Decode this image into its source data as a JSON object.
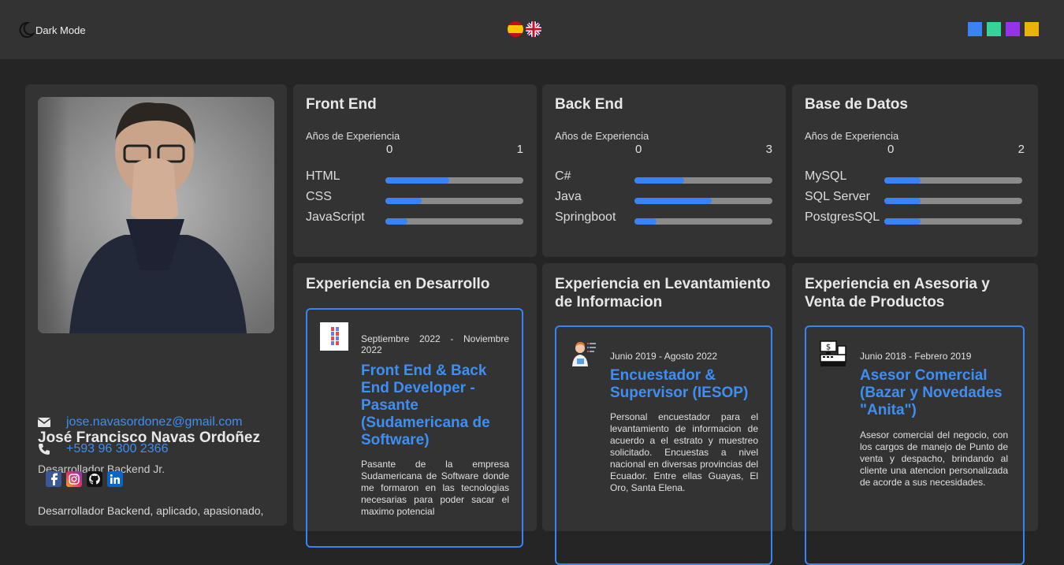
{
  "header": {
    "dark_mode_label": "Dark Mode",
    "flags": [
      "spain-flag-icon",
      "uk-flag-icon"
    ],
    "theme_colors": [
      "#3b82f6",
      "#34d399",
      "#9333ea",
      "#eab308"
    ]
  },
  "profile": {
    "name": "José Francisco Navas Ordoñez",
    "role": "Desarrollador Backend Jr.",
    "email": "jose.navasordonez@gmail.com",
    "phone": "+593 96 300 2366",
    "social": [
      "facebook-icon",
      "instagram-icon",
      "github-icon",
      "linkedin-icon"
    ],
    "bio": "Desarrollador Backend, aplicado, apasionado,"
  },
  "skills": [
    {
      "title": "Front End",
      "years_label": "Años de Experiencia",
      "scale_min": "0",
      "scale_max": "1",
      "items": [
        {
          "label": "HTML",
          "level": 0.46
        },
        {
          "label": "CSS",
          "level": 0.26
        },
        {
          "label": "JavaScript",
          "level": 0.16
        }
      ]
    },
    {
      "title": "Back End",
      "years_label": "Años de Experiencia",
      "scale_min": "0",
      "scale_max": "3",
      "items": [
        {
          "label": "C#",
          "level": 0.36
        },
        {
          "label": "Java",
          "level": 0.56
        },
        {
          "label": "Springboot",
          "level": 0.16
        }
      ]
    },
    {
      "title": "Base de Datos",
      "years_label": "Años de Experiencia",
      "scale_min": "0",
      "scale_max": "2",
      "items": [
        {
          "label": "MySQL",
          "level": 0.26
        },
        {
          "label": "SQL Server",
          "level": 0.26
        },
        {
          "label": "PostgresSQL",
          "level": 0.26
        }
      ]
    }
  ],
  "experience": [
    {
      "section_title": "Experiencia en Desarrollo",
      "date": "Septiembre 2022 - Noviembre 2022",
      "title": "Front End & Back End Developer - Pasante (Sudamericana de Software)",
      "description": "Pasante de la empresa Sudamericana de Software donde me formaron en las tecnologias necesarias para poder sacar el maximo potencial"
    },
    {
      "section_title": "Experiencia en Levantamiento de Informacion",
      "date": "Junio 2019 - Agosto 2022",
      "title": "Encuestador & Supervisor (IESOP)",
      "description": "Personal encuestador para el levantamiento de informacion de acuerdo a el estrato y muestreo solicitado. Encuestas a nivel nacional en diversas provincias del Ecuador. Entre ellas Guayas, El Oro, Santa Elena."
    },
    {
      "section_title": "Experiencia en Asesoria y Venta de Productos",
      "date": "Junio 2018 - Febrero 2019",
      "title": "Asesor Comercial (Bazar y Novedades \"Anita\")",
      "description": "Asesor comercial del negocio, con los cargos de manejo de Punto de venta y despacho, brindando al cliente una atencion personalizada de acorde a sus necesidades."
    }
  ]
}
